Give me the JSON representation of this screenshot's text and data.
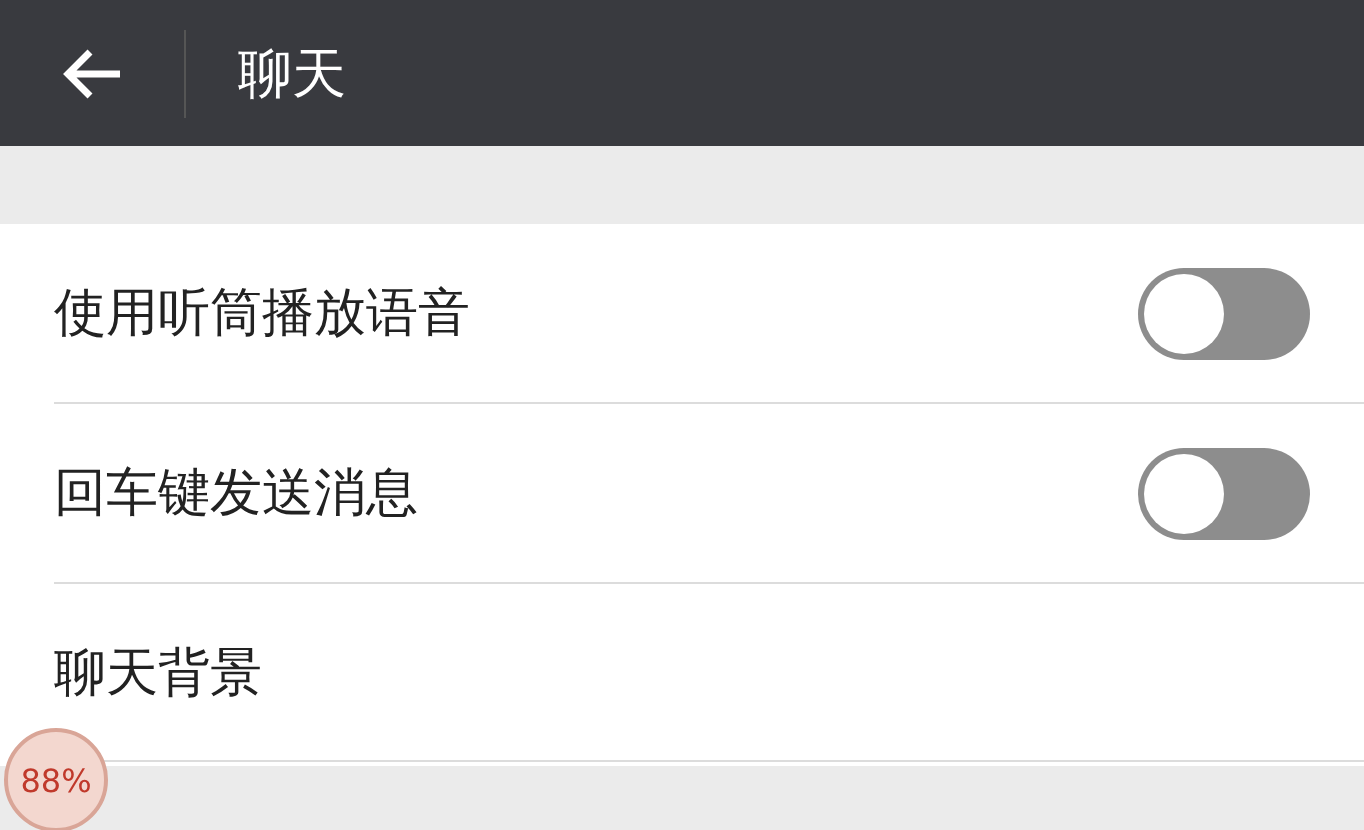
{
  "header": {
    "title": "聊天"
  },
  "settings": [
    {
      "kind": "toggle",
      "label": "使用听筒播放语音",
      "on": false
    },
    {
      "kind": "toggle",
      "label": "回车键发送消息",
      "on": false
    },
    {
      "kind": "link",
      "label": "聊天背景"
    }
  ],
  "float_ball": {
    "text": "88%"
  }
}
